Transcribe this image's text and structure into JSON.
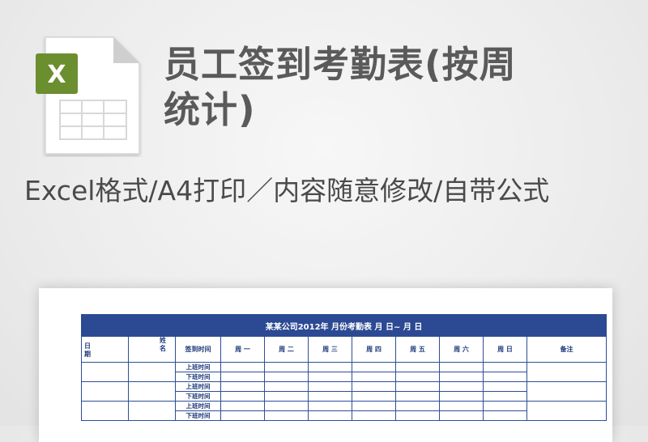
{
  "title_line1": "员工签到考勤表(按周",
  "title_line2": "统计)",
  "subtitle": "Excel格式/A4打印／内容随意修改/自带公式",
  "icon": {
    "name": "excel-file-icon",
    "letter": "X",
    "accent": "#6b8e2f"
  },
  "sheet": {
    "heading": "某某公司2012年  月份考勤表        月  日~    月    日",
    "columns": {
      "date_label": "日期",
      "date_ch1": "日",
      "date_ch2": "期",
      "name_label": "姓名",
      "name_ch1": "姓",
      "name_ch2": "名",
      "checkin": "签到时间",
      "mon": "周 一",
      "tue": "周 二",
      "wed": "周 三",
      "thu": "周 四",
      "fri": "周 五",
      "sat": "周 六",
      "sun": "周 日",
      "remark": "备注"
    },
    "rows": [
      "上班时间",
      "下班时间",
      "上班时间",
      "下班时间",
      "上班时间",
      "下班时间"
    ]
  },
  "colors": {
    "header_blue": "#2b4a93",
    "text_gray": "#5a5a5a"
  }
}
